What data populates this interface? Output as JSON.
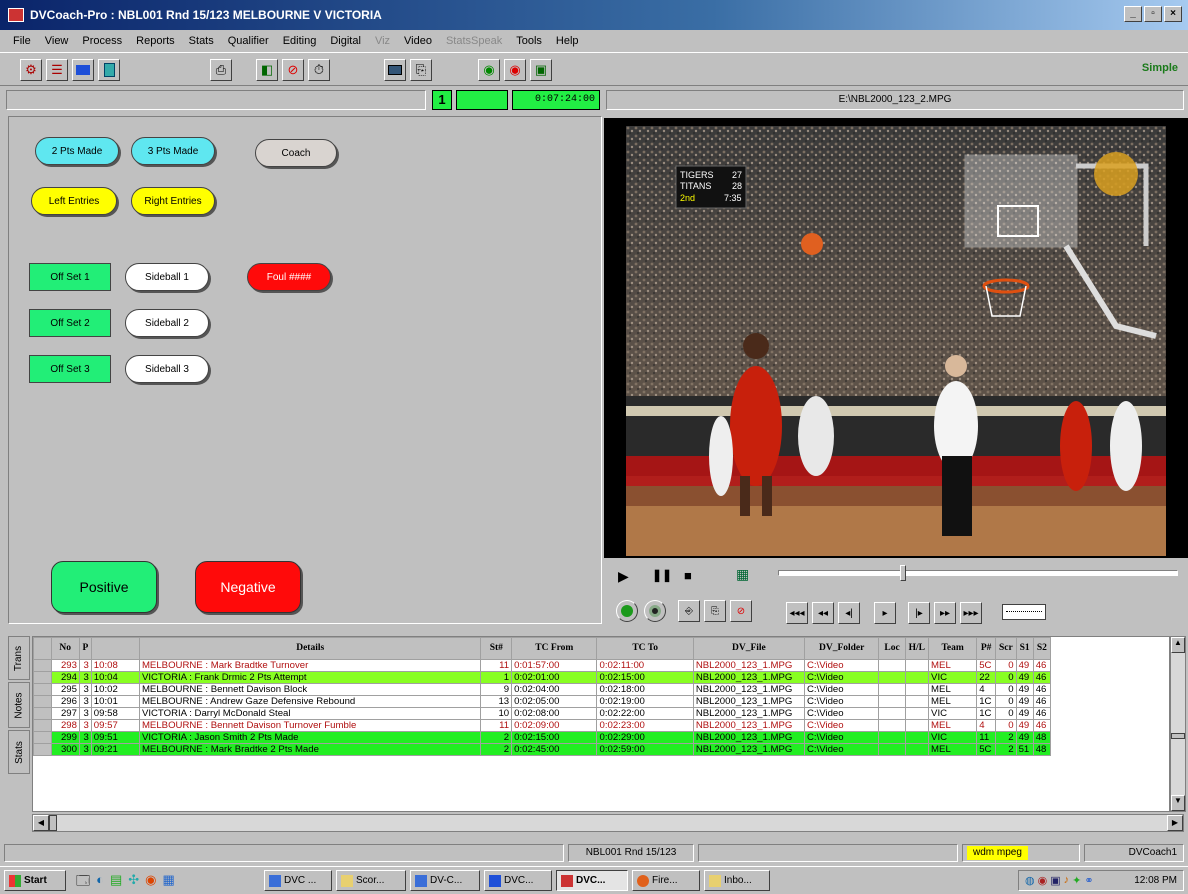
{
  "window": {
    "title": "DVCoach-Pro : NBL001 Rnd 15/123 MELBOURNE V VICTORIA"
  },
  "menu": [
    "File",
    "View",
    "Process",
    "Reports",
    "Stats",
    "Qualifier",
    "Editing",
    "Digital",
    "Viz",
    "Video",
    "StatsSpeak",
    "Tools",
    "Help"
  ],
  "toolbar": {
    "mode_label": "Simple"
  },
  "status_row": {
    "period": "1",
    "clock": "0:07:24:00",
    "video_file": "E:\\NBL2000_123_2.MPG"
  },
  "buttons": {
    "two_pts_made": "2 Pts Made",
    "three_pts_made": "3 Pts Made",
    "coach": "Coach",
    "left_entries": "Left Entries",
    "right_entries": "Right Entries",
    "off_set_1": "Off Set 1",
    "off_set_2": "Off Set 2",
    "off_set_3": "Off Set 3",
    "sideball_1": "Sideball 1",
    "sideball_2": "Sideball 2",
    "sideball_3": "Sideball 3",
    "foul": "Foul ####",
    "positive": "Positive",
    "negative": "Negative"
  },
  "scoreboard": {
    "team1": "TIGERS",
    "score1": "27",
    "team2": "TITANS",
    "score2": "28",
    "period": "2nd",
    "time": "7:35"
  },
  "side_tabs": [
    "Trans",
    "Notes",
    "Stats"
  ],
  "table": {
    "columns": [
      "No",
      "P",
      "",
      "Details",
      "St#",
      "TC From",
      "TC To",
      "DV_File",
      "DV_Folder",
      "Loc",
      "H/L",
      "Team",
      "P#",
      "Scr",
      "S1",
      "S2"
    ],
    "rows": [
      {
        "no": "293",
        "p": "3",
        "t": "10:08",
        "details": "MELBOURNE : Mark Bradtke  Turnover",
        "st": "11",
        "from": "0:01:57:00",
        "to": "0:02:11:00",
        "file": "NBL2000_123_1.MPG",
        "folder": "C:\\Video",
        "loc": "",
        "hl": "",
        "team": "MEL",
        "pnum": "5C",
        "scr": "0",
        "s1": "49",
        "s2": "46",
        "style": "red"
      },
      {
        "no": "294",
        "p": "3",
        "t": "10:04",
        "details": "VICTORIA : Frank Drmic  2 Pts Attempt",
        "st": "1",
        "from": "0:02:01:00",
        "to": "0:02:15:00",
        "file": "NBL2000_123_1.MPG",
        "folder": "C:\\Video",
        "loc": "",
        "hl": "",
        "team": "VIC",
        "pnum": "22",
        "scr": "0",
        "s1": "49",
        "s2": "46",
        "style": "lime"
      },
      {
        "no": "295",
        "p": "3",
        "t": "10:02",
        "details": "MELBOURNE : Bennett Davison  Block",
        "st": "9",
        "from": "0:02:04:00",
        "to": "0:02:18:00",
        "file": "NBL2000_123_1.MPG",
        "folder": "C:\\Video",
        "loc": "",
        "hl": "",
        "team": "MEL",
        "pnum": "4",
        "scr": "0",
        "s1": "49",
        "s2": "46",
        "style": "plain"
      },
      {
        "no": "296",
        "p": "3",
        "t": "10:01",
        "details": "MELBOURNE : Andrew Gaze  Defensive Rebound",
        "st": "13",
        "from": "0:02:05:00",
        "to": "0:02:19:00",
        "file": "NBL2000_123_1.MPG",
        "folder": "C:\\Video",
        "loc": "",
        "hl": "",
        "team": "MEL",
        "pnum": "1C",
        "scr": "0",
        "s1": "49",
        "s2": "46",
        "style": "plain"
      },
      {
        "no": "297",
        "p": "3",
        "t": "09:58",
        "details": "VICTORIA : Darryl McDonald  Steal",
        "st": "10",
        "from": "0:02:08:00",
        "to": "0:02:22:00",
        "file": "NBL2000_123_1.MPG",
        "folder": "C:\\Video",
        "loc": "",
        "hl": "",
        "team": "VIC",
        "pnum": "1C",
        "scr": "0",
        "s1": "49",
        "s2": "46",
        "style": "plain"
      },
      {
        "no": "298",
        "p": "3",
        "t": "09:57",
        "details": "MELBOURNE : Bennett Davison  Turnover  Fumble",
        "st": "11",
        "from": "0:02:09:00",
        "to": "0:02:23:00",
        "file": "NBL2000_123_1.MPG",
        "folder": "C:\\Video",
        "loc": "",
        "hl": "",
        "team": "MEL",
        "pnum": "4",
        "scr": "0",
        "s1": "49",
        "s2": "46",
        "style": "red"
      },
      {
        "no": "299",
        "p": "3",
        "t": "09:51",
        "details": "VICTORIA : Jason Smith  2 Pts Made",
        "st": "2",
        "from": "0:02:15:00",
        "to": "0:02:29:00",
        "file": "NBL2000_123_1.MPG",
        "folder": "C:\\Video",
        "loc": "",
        "hl": "",
        "team": "VIC",
        "pnum": "11",
        "scr": "2",
        "s1": "49",
        "s2": "48",
        "style": "green"
      },
      {
        "no": "300",
        "p": "3",
        "t": "09:21",
        "details": "MELBOURNE : Mark Bradtke  2 Pts Made",
        "st": "2",
        "from": "0:02:45:00",
        "to": "0:02:59:00",
        "file": "NBL2000_123_1.MPG",
        "folder": "C:\\Video",
        "loc": "",
        "hl": "",
        "team": "MEL",
        "pnum": "5C",
        "scr": "2",
        "s1": "51",
        "s2": "48",
        "style": "green"
      }
    ]
  },
  "statusbar": {
    "game": "NBL001 Rnd 15/123",
    "codec": "wdm mpeg",
    "user": "DVCoach1"
  },
  "taskbar": {
    "start": "Start",
    "tasks": [
      "DVC ...",
      "Scor...",
      "DV-C...",
      "DVC...",
      "DVC...",
      "Fire...",
      "Inbo..."
    ],
    "clock": "12:08 PM"
  }
}
